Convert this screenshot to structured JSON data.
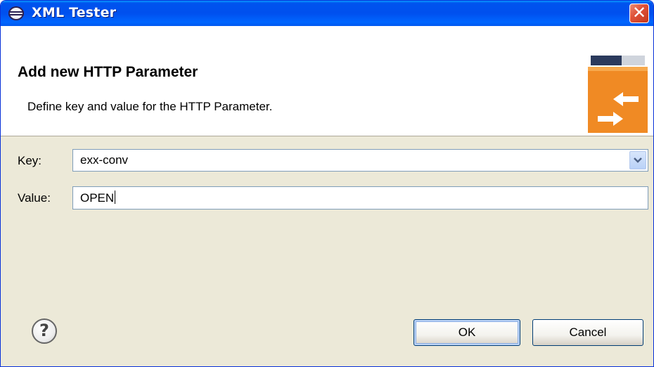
{
  "window": {
    "title": "XML Tester",
    "close_label": "✕"
  },
  "banner": {
    "title": "Add new HTTP Parameter",
    "description": "Define key and value for the HTTP Parameter."
  },
  "form": {
    "key_label": "Key:",
    "key_value": "exx-conv",
    "value_label": "Value:",
    "value_value": "OPEN"
  },
  "buttons": {
    "help_label": "?",
    "ok_label": "OK",
    "cancel_label": "Cancel"
  },
  "colors": {
    "titlebar": "#0053ee",
    "dialog_bg": "#ece9d8",
    "banner_accent": "#f08a24"
  },
  "icons": {
    "title": "eclipse-icon",
    "banner": "exchange-arrows-icon",
    "help": "help-icon",
    "combo": "chevron-down-icon"
  }
}
